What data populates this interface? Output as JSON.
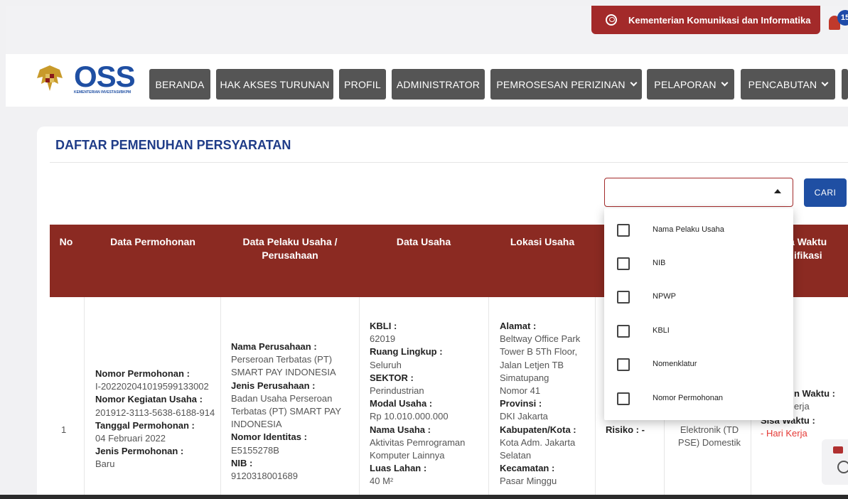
{
  "header": {
    "user_name": "Kementerian Komunikasi dan Informatika",
    "notification_count": "15"
  },
  "logo": {
    "brand": "OSS",
    "tagline": "KEMENTERIAN INVESTASI/BKPM"
  },
  "nav": {
    "items": [
      {
        "label": "BERANDA"
      },
      {
        "label": "HAK AKSES TURUNAN"
      },
      {
        "label": "PROFIL"
      },
      {
        "label": "ADMINISTRATOR"
      },
      {
        "label": "PEMROSESAN PERIZINAN"
      },
      {
        "label": "PELAPORAN"
      },
      {
        "label": "PENCABUTAN"
      }
    ]
  },
  "page": {
    "title": "DAFTAR PEMENUHAN PERSYARATAN",
    "search_button": "CARI"
  },
  "filter": {
    "options": [
      "Nama Pelaku Usaha",
      "NIB",
      "NPWP",
      "KBLI",
      "Nomenklatur",
      "Nomor Permohonan"
    ]
  },
  "table": {
    "headers": {
      "no": "No",
      "data_permohonan": "Data Permohonan",
      "data_pelaku_1": "Data Pelaku Usaha /",
      "data_pelaku_2": "Perusahaan",
      "data_usaha": "Data Usaha",
      "lokasi_usaha": "Lokasi Usaha",
      "waktu_1": "a Waktu",
      "waktu_2": "ifikasi"
    },
    "row": {
      "no": "1",
      "permohonan": {
        "nomor_label": "Nomor Permohonan :",
        "nomor": "I-202202041019599133002",
        "kegiatan_label": "Nomor Kegiatan Usaha :",
        "kegiatan": "201912-3113-5638-6188-914",
        "tanggal_label": "Tanggal Permohonan :",
        "tanggal": "04 Februari 2022",
        "jenis_label": "Jenis Permohonan :",
        "jenis": "Baru"
      },
      "pelaku": {
        "nama_label": "Nama Perusahaan :",
        "nama_1": "Perseroan Terbatas (PT)",
        "nama_2": "SMART PAY INDONESIA",
        "jenis_label": "Jenis Perusahaan :",
        "jenis_1": "Badan Usaha Perseroan",
        "jenis_2": "Terbatas (PT) SMART PAY",
        "jenis_3": "INDONESIA",
        "identitas_label": "Nomor Identitas :",
        "identitas": "E5155278B",
        "nib_label": "NIB :",
        "nib": "9120318001689"
      },
      "usaha": {
        "kbli_label": "KBLI :",
        "kbli": "62019",
        "ruang_label": "Ruang Lingkup :",
        "ruang": "Seluruh",
        "sektor_label": "SEKTOR :",
        "sektor": "Perindustrian",
        "modal_label": "Modal Usaha :",
        "modal": "Rp 10.010.000.000",
        "nama_label": "Nama Usaha :",
        "nama_1": "Aktivitas Pemrograman",
        "nama_2": "Komputer Lainnya",
        "luas_label": "Luas Lahan :",
        "luas": "40 M²"
      },
      "lokasi": {
        "alamat_label": "Alamat :",
        "alamat_1": "Beltway Office Park",
        "alamat_2": "Tower B 5Th Floor,",
        "alamat_3": "Jalan Letjen TB",
        "alamat_4": "Simatupang",
        "alamat_5": "Nomor 41",
        "provinsi_label": "Provinsi :",
        "provinsi": "DKI Jakarta",
        "kabkota_label": "Kabupaten/Kota :",
        "kabkota_1": "Kota Adm. Jakarta",
        "kabkota_2": "Selatan",
        "kecamatan_label": "Kecamatan :",
        "kecamatan": "Pasar Minggu"
      },
      "risiko": "Risiko : -",
      "izin_1": "Elektronik (TD",
      "izin_2": "PSE) Domestik",
      "waktu": {
        "w1": "n Waktu :",
        "w2": "erja",
        "w3": "Sisa Waktu :",
        "w4": "- Hari Kerja"
      }
    }
  }
}
